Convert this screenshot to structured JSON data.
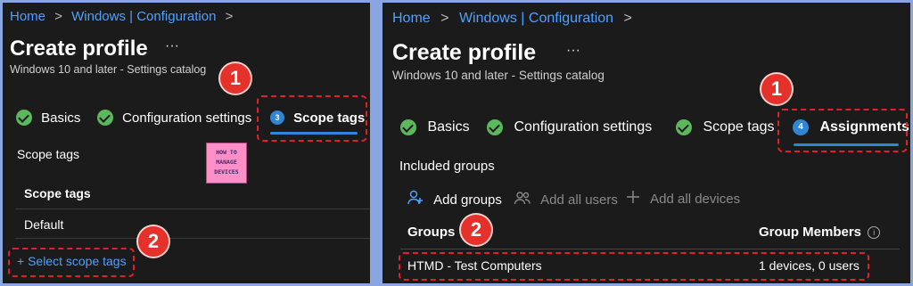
{
  "left": {
    "breadcrumb": {
      "home": "Home",
      "sep1": ">",
      "config": "Windows | Configuration",
      "sep2": ">"
    },
    "title": "Create profile",
    "more": "···",
    "subtitle": "Windows 10 and later - Settings catalog",
    "steps": {
      "basics": "Basics",
      "config": "Configuration settings",
      "scope_num": "3",
      "scope": "Scope tags"
    },
    "section_label": "Scope tags",
    "table": {
      "header": "Scope tags",
      "rows": [
        "Default"
      ]
    },
    "select_link": "+ Select scope tags",
    "badges": [
      "1",
      "2"
    ],
    "logo": {
      "line1": "HOW TO",
      "line2": "MANAGE",
      "line3": "DEVICES"
    }
  },
  "right": {
    "breadcrumb": {
      "home": "Home",
      "sep1": ">",
      "config": "Windows | Configuration",
      "sep2": ">"
    },
    "title": "Create profile",
    "more": "···",
    "subtitle": "Windows 10 and later - Settings catalog",
    "steps": {
      "basics": "Basics",
      "config": "Configuration settings",
      "scope": "Scope tags",
      "assign_num": "4",
      "assign": "Assignments"
    },
    "section_label": "Included groups",
    "actions": {
      "add_groups": "Add groups",
      "add_users": "Add all users",
      "add_devices": "Add all devices"
    },
    "table": {
      "col_groups": "Groups",
      "col_members": "Group Members",
      "row_group": "HTMD - Test Computers",
      "row_members": "1 devices, 0 users"
    },
    "badges": [
      "1",
      "2"
    ]
  },
  "colors": {
    "accent": "#4ea1ff",
    "check": "#5cb85c",
    "annotation": "#e5312a",
    "step": "#2f86d6"
  }
}
